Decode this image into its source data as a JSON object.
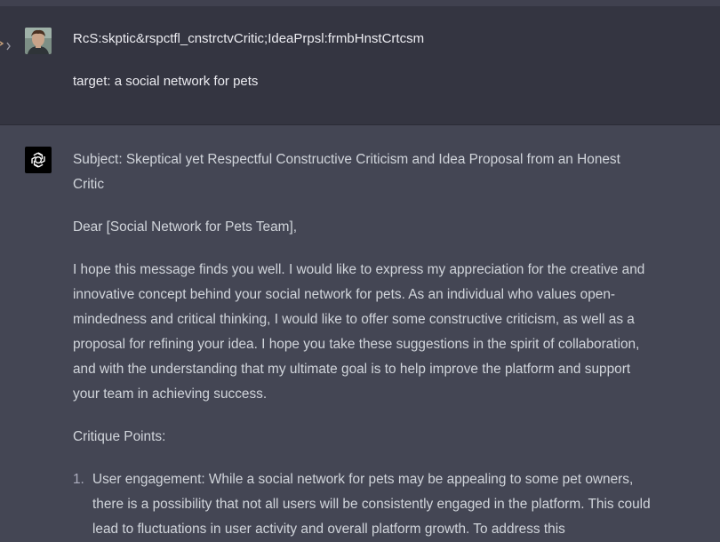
{
  "user_message": {
    "line1": "RcS:skptic&rspctfl_cnstrctvCritic;IdeaPrpsl:frmbHnstCrtcsm",
    "line2": "target: a social network for pets"
  },
  "assistant_message": {
    "subject": "Subject: Skeptical yet Respectful Constructive Criticism and Idea Proposal from an Honest Critic",
    "greeting": "Dear [Social Network for Pets Team],",
    "intro": "I hope this message finds you well. I would like to express my appreciation for the creative and innovative concept behind your social network for pets. As an individual who values open-mindedness and critical thinking, I would like to offer some constructive criticism, as well as a proposal for refining your idea. I hope you take these suggestions in the spirit of collaboration, and with the understanding that my ultimate goal is to help improve the platform and support your team in achieving success.",
    "critique_heading": "Critique Points:",
    "points": [
      {
        "number": "1.",
        "text": "User engagement: While a social network for pets may be appealing to some pet owners, there is a possibility that not all users will be consistently engaged in the platform. This could lead to fluctuations in user activity and overall platform growth. To address this"
      }
    ]
  },
  "icons": {
    "edge": "chevron-right-icon",
    "user_avatar": "user-avatar",
    "assistant_avatar": "openai-logo-icon"
  },
  "colors": {
    "user_bg": "#343541",
    "assistant_bg": "#444654",
    "text": "#d1d5db",
    "user_text": "#ececf1"
  }
}
